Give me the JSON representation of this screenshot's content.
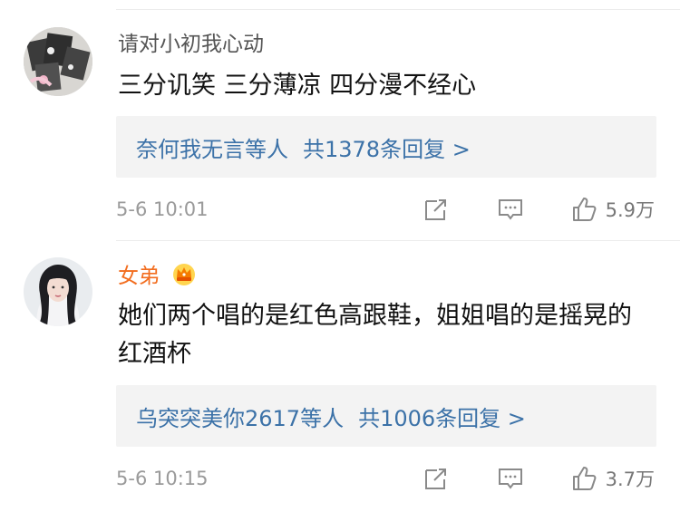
{
  "comments": [
    {
      "username": "请对小初我心动",
      "text": "三分讥笑 三分薄凉 四分漫不经心",
      "reply_preview": {
        "names": "奈何我无言等人",
        "count_text": "共1378条回复 >"
      },
      "time": "5-6 10:01",
      "likes": "5.9万",
      "avatar_icon": "cards-photo-avatar"
    },
    {
      "username": "女弟",
      "username_badge": "crown-badge-icon",
      "text": "她们两个唱的是红色高跟鞋，姐姐唱的是摇晃的红酒杯",
      "reply_preview": {
        "names": "乌突突美你2617等人",
        "count_text": "共1006条回复 >"
      },
      "time": "5-6 10:15",
      "likes": "3.7万",
      "avatar_icon": "woman-portrait-avatar"
    }
  ],
  "colors": {
    "link": "#3c72a8",
    "username_vip": "#f26d1f",
    "meta": "#9a9a9a",
    "reply_bg": "#f3f3f3"
  }
}
